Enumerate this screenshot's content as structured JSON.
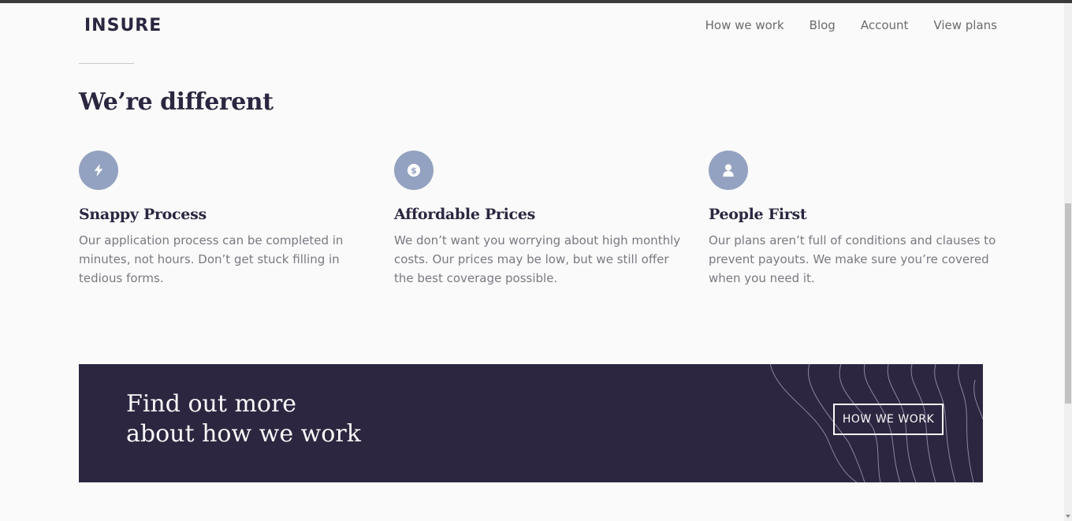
{
  "header": {
    "logo": "INSURE",
    "nav": [
      "How we work",
      "Blog",
      "Account",
      "View plans"
    ]
  },
  "section": {
    "title": "We’re different",
    "features": [
      {
        "icon": "lightning-icon",
        "title": "Snappy Process",
        "text": "Our application process can be completed in minutes, not hours. Don’t get stuck filling in tedious forms."
      },
      {
        "icon": "dollar-icon",
        "title": "Affordable Prices",
        "text": "We don’t want you worrying about high monthly costs. Our prices may be low, but we still offer the best coverage possible."
      },
      {
        "icon": "person-icon",
        "title": "People First",
        "text": "Our plans aren’t full of conditions and clauses to prevent payouts. We make sure you’re covered when you need it."
      }
    ]
  },
  "banner": {
    "title_line1": "Find out more",
    "title_line2": "about how we work",
    "button": "HOW WE WORK"
  },
  "colors": {
    "dark": "#2c2640",
    "icon_bg": "#93a2c0",
    "text_gray": "#7a7880",
    "background": "#fafafa"
  }
}
